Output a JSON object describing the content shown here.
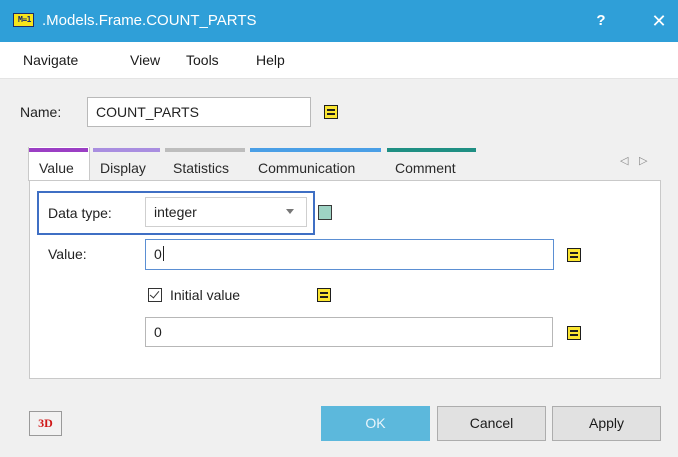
{
  "window": {
    "title": ".Models.Frame.COUNT_PARTS",
    "icon_text": "M=1",
    "help_label": "?",
    "close_label": "✕",
    "accent": "#2f9fd8"
  },
  "menu": {
    "items": [
      {
        "label": "Navigate"
      },
      {
        "label": "View"
      },
      {
        "label": "Tools"
      },
      {
        "label": "Help"
      }
    ]
  },
  "name": {
    "label": "Name:",
    "value": "COUNT_PARTS"
  },
  "tabs": {
    "items": [
      {
        "label": "Value",
        "color": "#9b3fc4",
        "active": true
      },
      {
        "label": "Display",
        "color": "#a98ee0",
        "active": false
      },
      {
        "label": "Statistics",
        "color": "#bdbdbd",
        "active": false
      },
      {
        "label": "Communication",
        "color": "#4a9fe6",
        "active": false
      },
      {
        "label": "Comment",
        "color": "#1f8f83",
        "active": false
      }
    ],
    "nav_prev": "◁",
    "nav_next": "▷"
  },
  "value_tab": {
    "data_type_label": "Data type:",
    "data_type_value": "integer",
    "value_label": "Value:",
    "value_value": "0",
    "initial_value_label": "Initial value",
    "initial_value_checked": true,
    "initial_value_value": "0"
  },
  "buttons": {
    "three_d": "3D",
    "ok": "OK",
    "cancel": "Cancel",
    "apply": "Apply"
  }
}
